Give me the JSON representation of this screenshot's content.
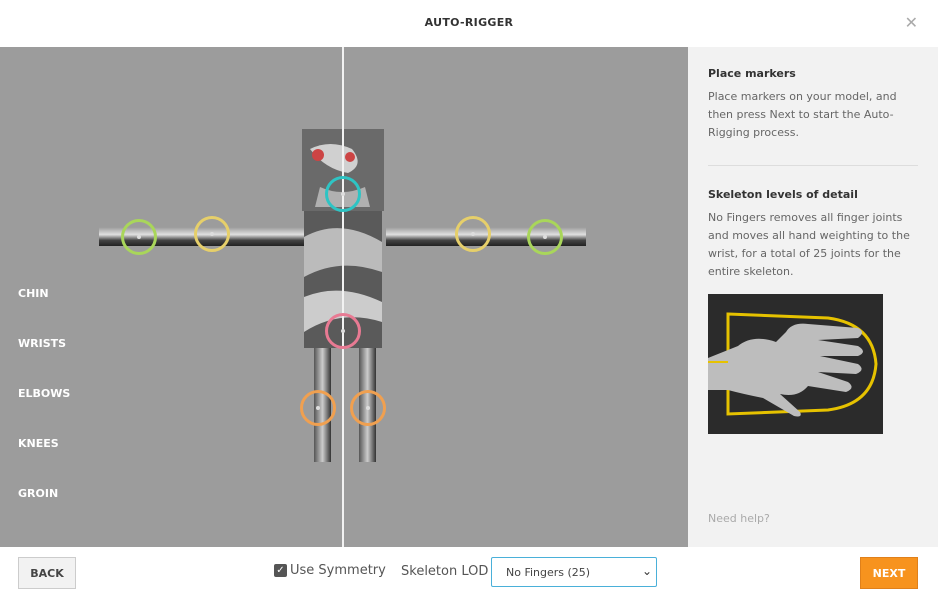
{
  "window": {
    "title": "AUTO-RIGGER",
    "close_icon": "close-icon"
  },
  "markers": {
    "labels": [
      "CHIN",
      "WRISTS",
      "ELBOWS",
      "KNEES",
      "GROIN"
    ],
    "colors": {
      "chin": "#2ec4c4",
      "wrists": "#a9d65a",
      "elbows": "#e6cf6a",
      "knees": "#f0a050",
      "groin": "#e87a93"
    }
  },
  "panel": {
    "place_title": "Place markers",
    "place_text": "Place markers on your model, and then press Next to start the Auto-Rigging process.",
    "lod_title": "Skeleton levels of detail",
    "lod_text": "No Fingers removes all finger joints and moves all hand weighting to the wrist, for a total of 25 joints for the entire skeleton.",
    "help_link": "Need help?"
  },
  "footer": {
    "back_label": "BACK",
    "symmetry_label": "Use Symmetry",
    "symmetry_checked": true,
    "lod_label": "Skeleton LOD",
    "lod_selected": "No Fingers (25)",
    "next_label": "NEXT"
  },
  "colors": {
    "accent": "#f7931e",
    "viewport_bg": "#9c9c9c",
    "panel_bg": "#f2f2f2",
    "focus": "#4ab0d9"
  }
}
